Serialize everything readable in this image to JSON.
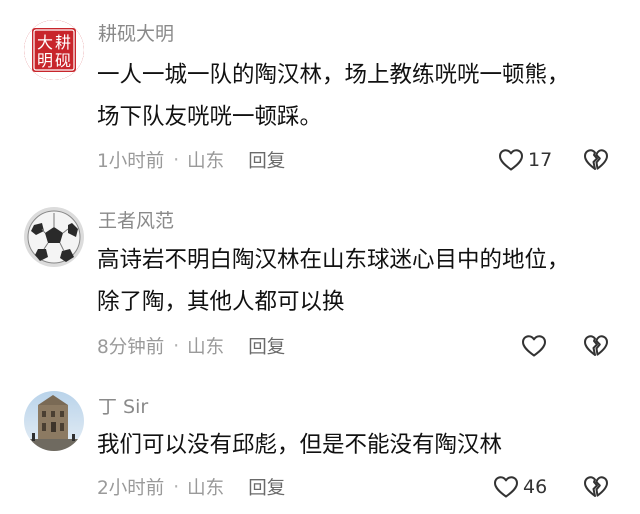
{
  "comments": [
    {
      "username": "耕砚大明",
      "avatar_icon": "seal-avatar",
      "avatar_text": [
        "耕",
        "大",
        "砚",
        "明"
      ],
      "lines": [
        "一人一城一队的陶汉林，场上教练咣咣一顿熊，",
        "场下队友咣咣一顿踩。"
      ],
      "time": "1小时前",
      "separator": "·",
      "location": "山东",
      "reply_label": "回复",
      "like_count": "17"
    },
    {
      "username": "王者风范",
      "avatar_icon": "soccer-ball-avatar",
      "lines": [
        "高诗岩不明白陶汉林在山东球迷心目中的地位，",
        "除了陶，其他人都可以换"
      ],
      "time": "8分钟前",
      "separator": "·",
      "location": "山东",
      "reply_label": "回复",
      "like_count": ""
    },
    {
      "username": "丁 Sir",
      "avatar_icon": "ruins-photo-avatar",
      "lines": [
        "我们可以没有邱彪，但是不能没有陶汉林"
      ],
      "time": "2小时前",
      "separator": "·",
      "location": "山东",
      "reply_label": "回复",
      "like_count": "46"
    }
  ],
  "colors": {
    "username": "#8a8a8a",
    "text": "#111111",
    "meta": "#9a9a9a",
    "icon": "#333333",
    "seal_red": "#c8252b"
  }
}
